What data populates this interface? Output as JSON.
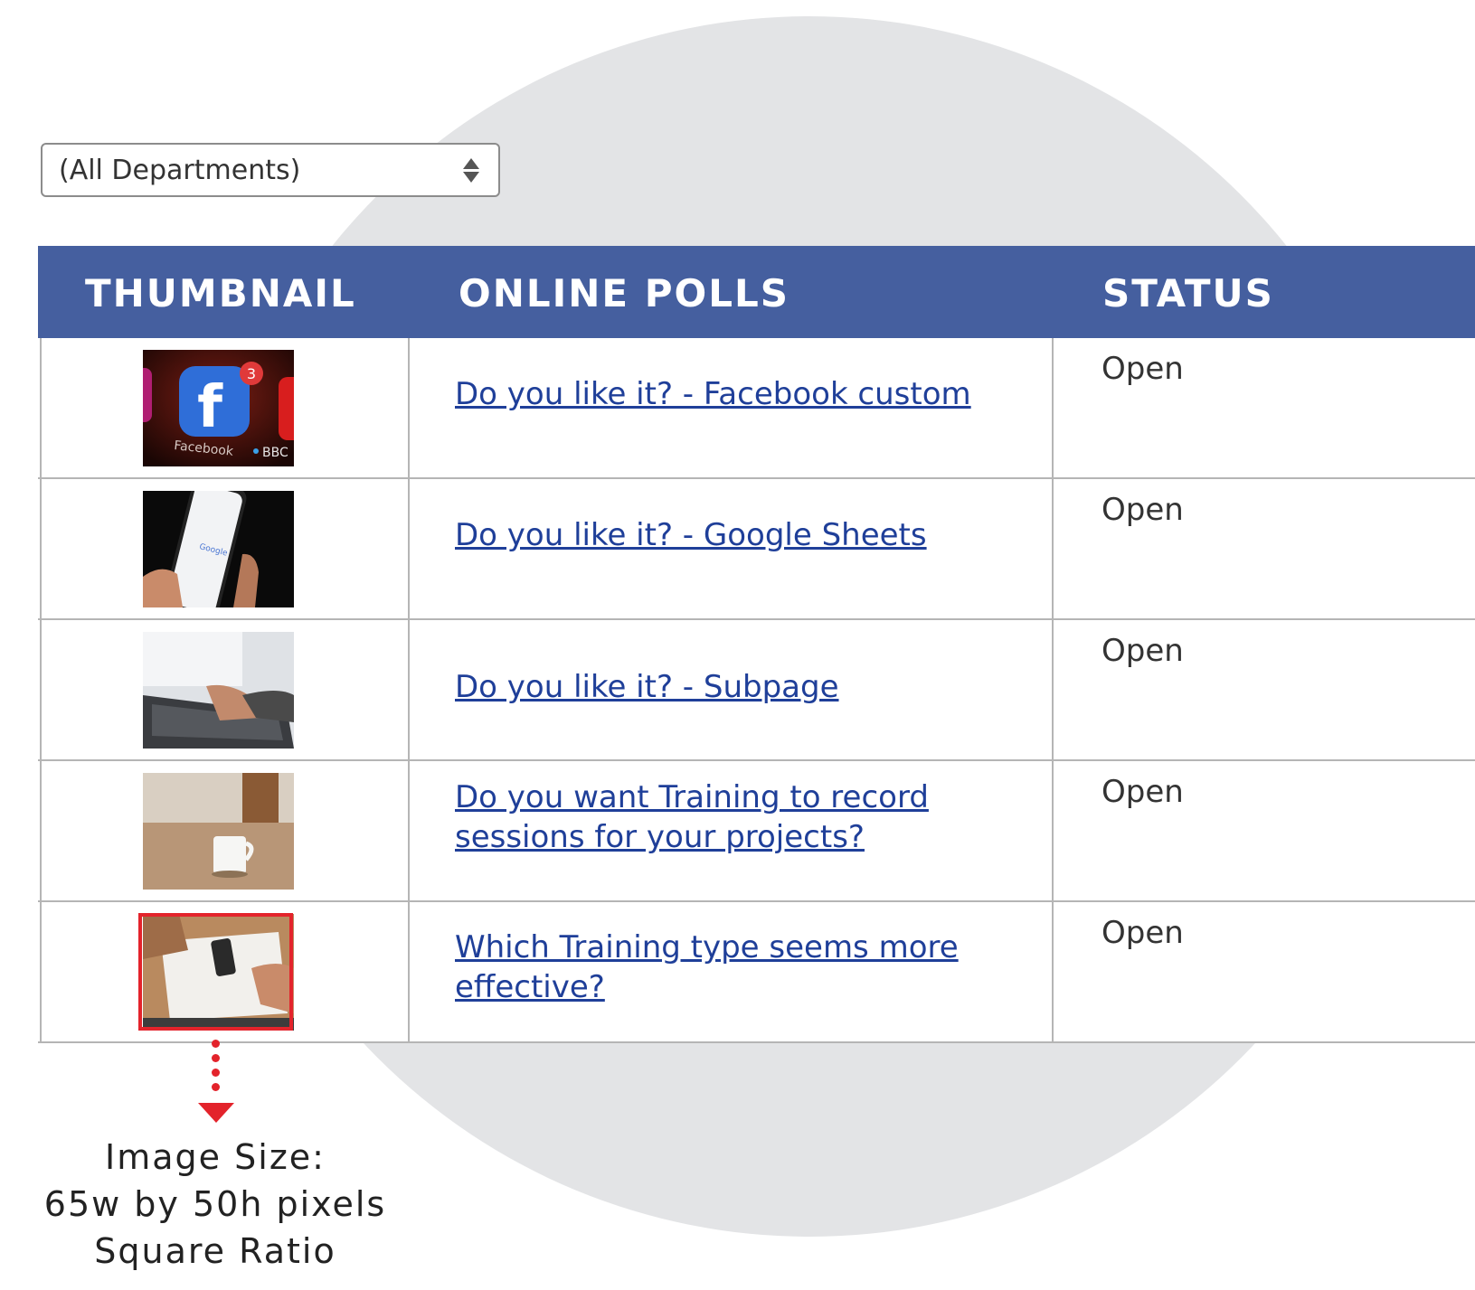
{
  "department_filter": {
    "selected": "(All Departments)"
  },
  "table": {
    "headers": {
      "thumbnail": "THUMBNAIL",
      "polls": "ONLINE POLLS",
      "status": "STATUS"
    },
    "rows": [
      {
        "thumbnail_icon": "facebook-app-photo",
        "title": "Do you like it? - Facebook custom",
        "status": "Open"
      },
      {
        "thumbnail_icon": "phone-google-photo",
        "title": "Do you like it? - Google Sheets",
        "status": "Open"
      },
      {
        "thumbnail_icon": "laptop-typing-photo",
        "title": "Do you like it? - Subpage",
        "status": "Open"
      },
      {
        "thumbnail_icon": "coffee-mug-photo",
        "title": "Do you want Training to record sessions for your projects?",
        "status": "Open"
      },
      {
        "thumbnail_icon": "desk-planning-photo",
        "title": "Which Training type seems more effective?",
        "status": "Open"
      }
    ]
  },
  "annotation": {
    "line1": "Image Size:",
    "line2": "65w by 50h pixels",
    "line3": "Square Ratio"
  },
  "colors": {
    "header_bg": "#455f9f",
    "link": "#1f3f99",
    "highlight": "#e3232b",
    "background_circle": "#e3e4e6"
  }
}
